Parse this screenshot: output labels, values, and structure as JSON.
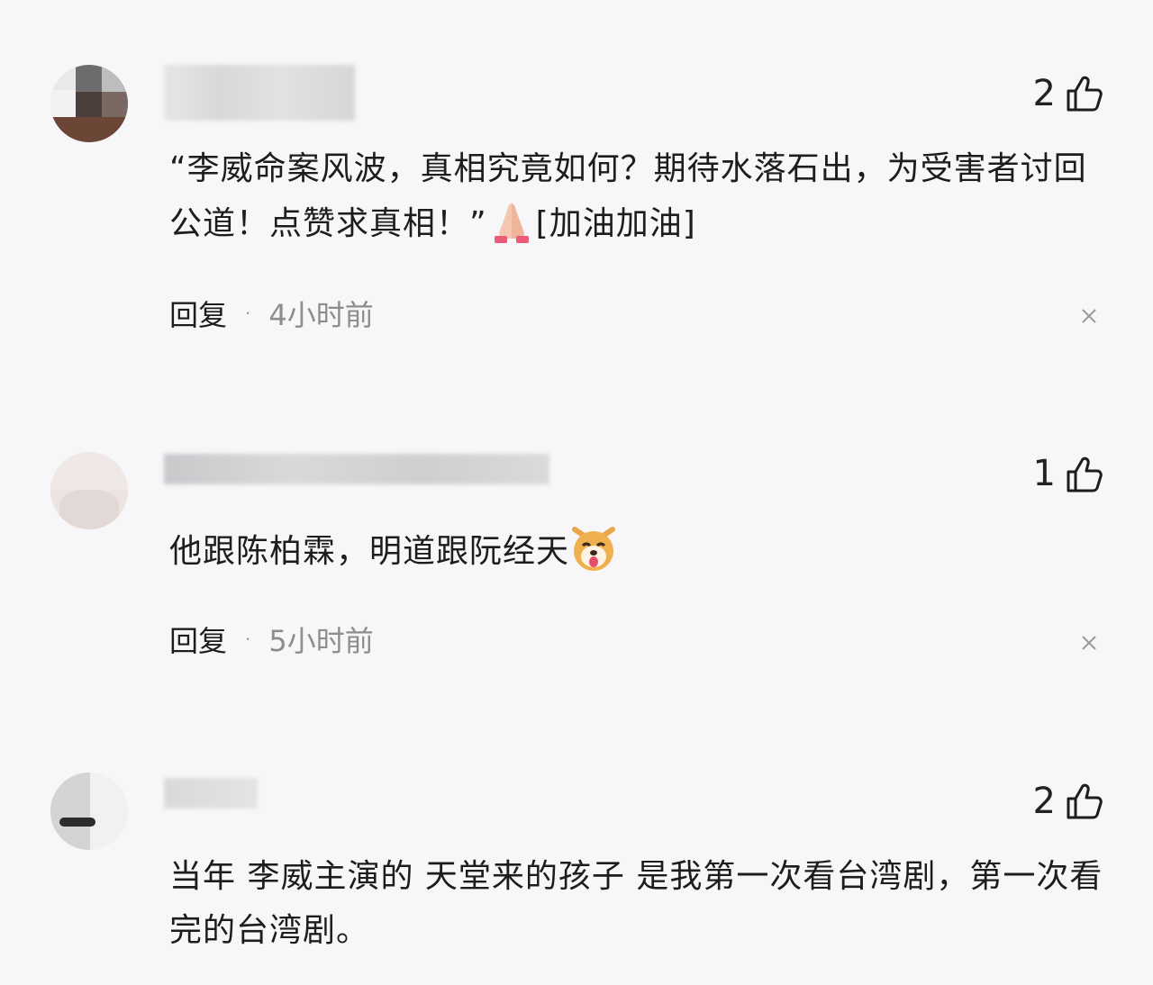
{
  "comments": [
    {
      "likes": "2",
      "text_before": "“李威命案风波，真相究竟如何？期待水落石出，为受害者讨回公道！点赞求真相！”",
      "emoji_icon": "folded-hands-icon",
      "text_after": "[加油加油]",
      "reply_label": "回复",
      "separator": "·",
      "time": "4小时前"
    },
    {
      "likes": "1",
      "text_before": "他跟陈柏霖，明道跟阮经天",
      "emoji_icon": "dog-face-tongue-icon",
      "text_after": "",
      "reply_label": "回复",
      "separator": "·",
      "time": "5小时前"
    },
    {
      "likes": "2",
      "text_before": "当年 李威主演的 天堂来的孩子 是我第一次看台湾剧，第一次看完的台湾剧。",
      "emoji_icon": "",
      "text_after": ""
    }
  ],
  "colors": {
    "background": "#f7f7f9",
    "text": "#1d1d1d",
    "muted": "#8d8d8d"
  }
}
